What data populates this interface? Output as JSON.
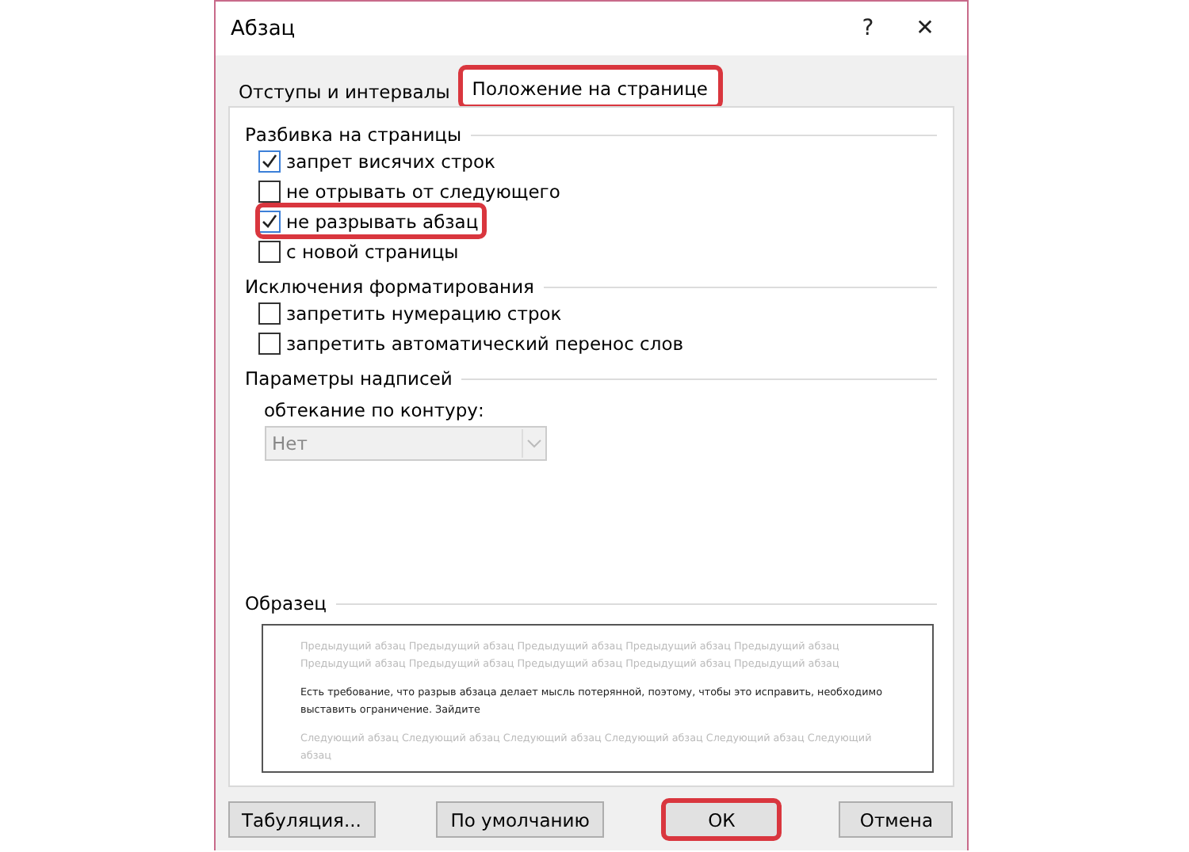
{
  "window": {
    "title": "Абзац",
    "help": "?",
    "close": "✕"
  },
  "tabs": [
    {
      "label": "Отступы и интервалы",
      "selected": false,
      "highlighted": false
    },
    {
      "label": "Положение на странице",
      "selected": true,
      "highlighted": true
    }
  ],
  "sections": [
    {
      "title": "Разбивка на страницы",
      "items": [
        {
          "kind": "checkbox",
          "label": "запрет висячих строк",
          "checked": true,
          "highlighted": false
        },
        {
          "kind": "checkbox",
          "label": "не отрывать от следующего",
          "checked": false,
          "highlighted": false
        },
        {
          "kind": "checkbox",
          "label": "не разрывать абзац",
          "checked": true,
          "highlighted": true
        },
        {
          "kind": "checkbox",
          "label": "с новой страницы",
          "checked": false,
          "highlighted": false
        }
      ]
    },
    {
      "title": "Исключения форматирования",
      "items": [
        {
          "kind": "checkbox",
          "label": "запретить нумерацию строк",
          "checked": false,
          "highlighted": false
        },
        {
          "kind": "checkbox",
          "label": "запретить автоматический перенос слов",
          "checked": false,
          "highlighted": false
        }
      ]
    },
    {
      "title": "Параметры надписей",
      "items": [
        {
          "kind": "select",
          "label": "обтекание по контуру:",
          "value": "Нет",
          "disabled": true
        }
      ]
    }
  ],
  "preview": {
    "title": "Образец",
    "before": "Предыдущий абзац Предыдущий абзац Предыдущий абзац Предыдущий абзац Предыдущий абзац Предыдущий абзац Предыдущий абзац Предыдущий абзац Предыдущий абзац Предыдущий абзац",
    "text": "Есть требование, что разрыв абзаца делает мысль потерянной, поэтому, чтобы это исправить, необходимо выставить ограничение. Зайдите",
    "after": "Следующий абзац Следующий абзац Следующий абзац Следующий абзац Следующий абзац Следующий абзац"
  },
  "buttons": [
    {
      "label": "Табуляция...",
      "highlighted": false
    },
    {
      "label": "По умолчанию",
      "highlighted": false
    },
    {
      "label": "ОК",
      "highlighted": true
    },
    {
      "label": "Отмена",
      "highlighted": false
    }
  ]
}
